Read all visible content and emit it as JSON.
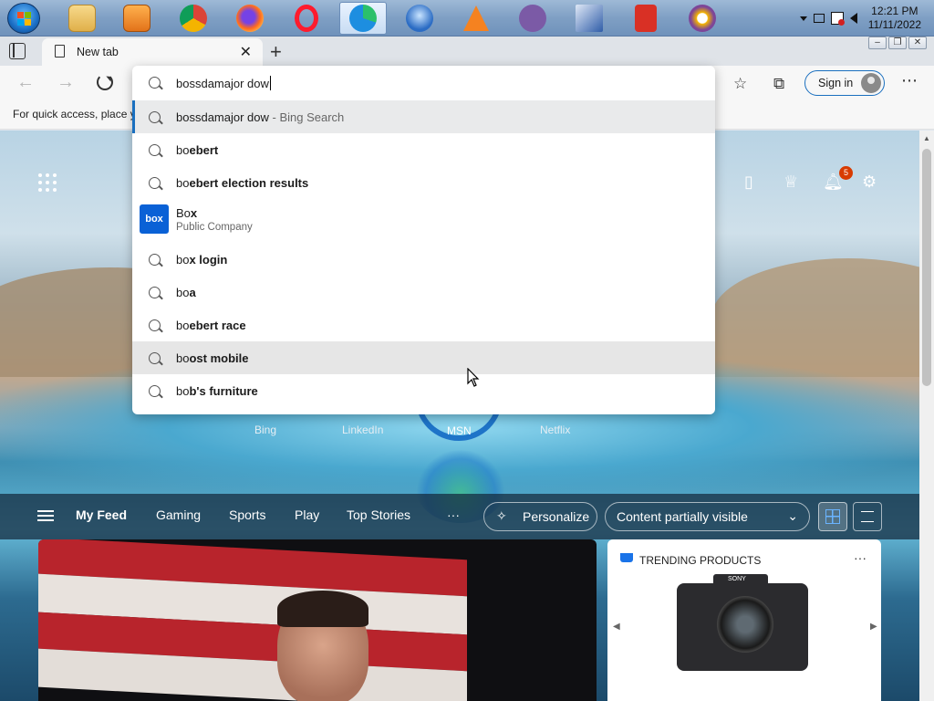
{
  "taskbar": {
    "apps": [
      {
        "name": "Windows Explorer",
        "color": "#e8c15a"
      },
      {
        "name": "Media Center",
        "color": "#f08a24"
      },
      {
        "name": "Google Chrome",
        "color": "#db4437"
      },
      {
        "name": "Firefox",
        "color": "#ff6a1e"
      },
      {
        "name": "Opera",
        "color": "#ff1b2d"
      },
      {
        "name": "Microsoft Edge",
        "color": "#1d8ee0",
        "active": true
      },
      {
        "name": "Thunderbird",
        "color": "#2b6cc4"
      },
      {
        "name": "VLC",
        "color": "#f58220"
      },
      {
        "name": "Pidgin",
        "color": "#7b5aa6"
      },
      {
        "name": "Text Editor",
        "color": "#2f5da8"
      },
      {
        "name": "Red App",
        "color": "#d93025"
      },
      {
        "name": "Tor Browser",
        "color": "#7d4698"
      }
    ],
    "clock": {
      "time": "12:21 PM",
      "date": "11/11/2022"
    }
  },
  "browser": {
    "tab_title": "New tab",
    "tab_close": "✕",
    "new_tab": "+",
    "sign_in_label": "Sign in",
    "favorites_hint": "For quick access, place y",
    "omnibox": {
      "query": "bossdamajor dow",
      "suggestions": [
        {
          "prefix": "bossdamajor dow",
          "bold": "",
          "suffix": " - Bing Search",
          "selected": true
        },
        {
          "prefix": "bo",
          "bold": "ebert",
          "suffix": ""
        },
        {
          "prefix": "bo",
          "bold": "ebert election results",
          "suffix": ""
        },
        {
          "prefix": "Bo",
          "bold": "x",
          "suffix": "",
          "entity": true,
          "subtitle": "Public Company",
          "logo": "box"
        },
        {
          "prefix": "bo",
          "bold": "x login",
          "suffix": ""
        },
        {
          "prefix": "bo",
          "bold": "a",
          "suffix": ""
        },
        {
          "prefix": "bo",
          "bold": "ebert race",
          "suffix": ""
        },
        {
          "prefix": "bo",
          "bold": "ost mobile",
          "suffix": "",
          "hover": true
        },
        {
          "prefix": "bo",
          "bold": "b's furniture",
          "suffix": ""
        }
      ]
    }
  },
  "newtab": {
    "notification_count": "5",
    "quick_links": [
      "Bing",
      "LinkedIn",
      "MSN",
      "Netflix"
    ],
    "feed_tabs": [
      "My Feed",
      "Gaming",
      "Sports",
      "Play",
      "Top Stories"
    ],
    "more": "···",
    "personalize_label": "Personalize",
    "visibility_label": "Content partially visible",
    "trending_title": "TRENDING PRODUCTS",
    "trending_more": "···",
    "camera_brand": "SONY"
  }
}
